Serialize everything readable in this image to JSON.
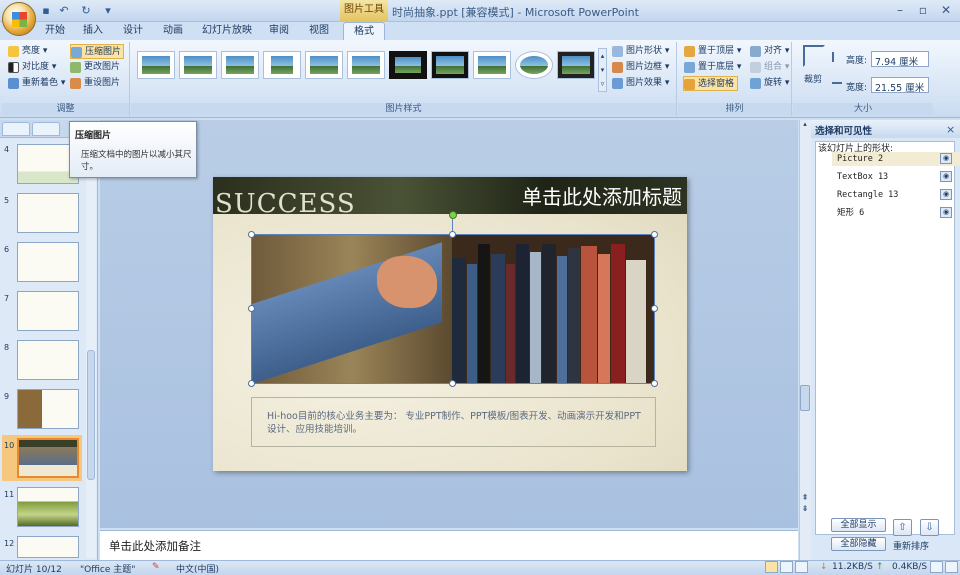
{
  "titlebar": {
    "contextual_tab": "图片工具",
    "window_title": "时尚抽象.ppt [兼容模式] - Microsoft PowerPoint",
    "quick_access": [
      "save",
      "undo",
      "redo",
      "customize"
    ],
    "window_buttons": [
      "minimize",
      "restore",
      "close"
    ]
  },
  "ribbon_tabs": [
    "开始",
    "插入",
    "设计",
    "动画",
    "幻灯片放映",
    "审阅",
    "视图",
    "格式"
  ],
  "ribbon": {
    "adjust": {
      "label": "调整",
      "brightness": "亮度",
      "contrast": "对比度",
      "recolor": "重新着色",
      "compress": "压缩图片",
      "change": "更改图片",
      "reset": "重设图片"
    },
    "styles": {
      "label": "图片样式",
      "shape": "图片形状",
      "border": "图片边框",
      "effects": "图片效果"
    },
    "arrange": {
      "label": "排列",
      "front": "置于顶层",
      "back": "置于底层",
      "pane": "选择窗格",
      "align": "对齐",
      "group": "组合",
      "rotate": "旋转"
    },
    "size": {
      "label": "大小",
      "crop": "裁剪",
      "height_label": "高度:",
      "height_value": "7.94 厘米",
      "width_label": "宽度:",
      "width_value": "21.55 厘米"
    }
  },
  "tooltip": {
    "title": "压缩图片",
    "desc": "压缩文档中的图片以减小其尺寸。"
  },
  "slides": {
    "numbers": [
      "4",
      "5",
      "6",
      "7",
      "8",
      "9",
      "10",
      "11",
      "12"
    ],
    "selected": "10"
  },
  "slide": {
    "banner_text": "SUCCESS",
    "title": "单击此处添加标题",
    "body": "Hi-hoo目前的核心业务主要为： 专业PPT制作、PPT模板/图表开发、动画演示开发和PPT设计、应用技能培训。"
  },
  "notes": {
    "placeholder": "单击此处添加备注"
  },
  "selection_pane": {
    "title": "选择和可见性",
    "subtitle": "该幻灯片上的形状:",
    "shapes": [
      "Picture 2",
      "TextBox 13",
      "Rectangle 13",
      "矩形 6"
    ],
    "selected_shape": "Picture 2",
    "show_all": "全部显示",
    "hide_all": "全部隐藏",
    "reorder": "重新排序"
  },
  "statusbar": {
    "slide_counter": "幻灯片 10/12",
    "theme": "\"Office 主题\"",
    "language": "中文(中国)",
    "down_speed": "11.2KB/S",
    "up_speed": "0.4KB/S"
  },
  "colors": {
    "accent": "#e68a2b",
    "ribbon": "#dce8f6",
    "contextual": "#e4c25e"
  }
}
